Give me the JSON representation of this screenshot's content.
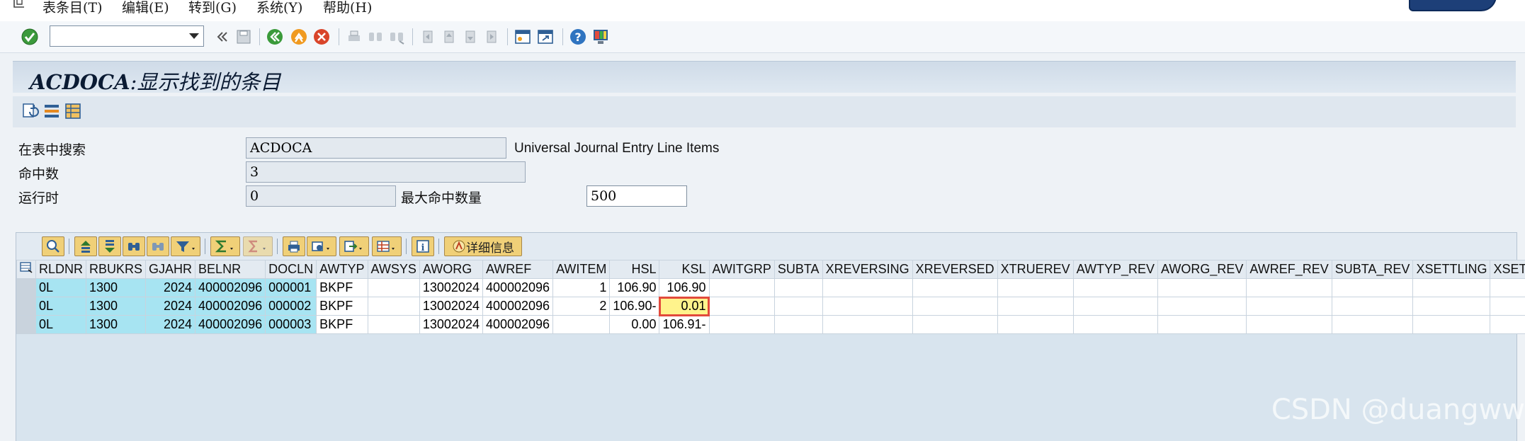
{
  "menu": {
    "items": [
      "表条目(T)",
      "编辑(E)",
      "转到(G)",
      "系统(Y)",
      "帮助(H)"
    ]
  },
  "toolbar": {
    "command_value": "",
    "icons": [
      "enter-icon",
      "back-icon",
      "exit-icon",
      "cancel-icon",
      "save-icon",
      "print-icon",
      "find-icon",
      "find-next-icon",
      "first-page-icon",
      "previous-page-icon",
      "next-page-icon",
      "last-page-icon",
      "create-session-icon",
      "shortcut-icon",
      "help-icon",
      "customize-layout-icon"
    ]
  },
  "title": {
    "table": "ACDOCA",
    "separator": ":",
    "text": "显示找到的条目"
  },
  "selection": {
    "search_label": "在表中搜索",
    "search_value": "ACDOCA",
    "search_desc": "Universal Journal Entry Line Items",
    "hits_label": "命中数",
    "hits_value": "3",
    "runtime_label": "运行时",
    "runtime_value": "0",
    "max_label": "最大命中数量",
    "max_value": "500"
  },
  "alv": {
    "detail_label": "详细信息",
    "columns": [
      "RLDNR",
      "RBUKRS",
      "GJAHR",
      "BELNR",
      "DOCLN",
      "AWTYP",
      "AWSYS",
      "AWORG",
      "AWREF",
      "AWITEM",
      "HSL",
      "KSL",
      "AWITGRP",
      "SUBTA",
      "XREVERSING",
      "XREVERSED",
      "XTRUEREV",
      "AWTYP_REV",
      "AWORG_REV",
      "AWREF_REV",
      "SUBTA_REV",
      "XSETTLING",
      "XSET..."
    ],
    "rows": [
      [
        "0L",
        "1300",
        "2024",
        "400002096",
        "000001",
        "BKPF",
        "",
        "13002024",
        "400002096",
        "1",
        "106.90",
        "106.90",
        "",
        "",
        "",
        "",
        "",
        "",
        "",
        "",
        "",
        "",
        ""
      ],
      [
        "0L",
        "1300",
        "2024",
        "400002096",
        "000002",
        "BKPF",
        "",
        "13002024",
        "400002096",
        "2",
        "106.90-",
        "0.01",
        "",
        "",
        "",
        "",
        "",
        "",
        "",
        "",
        "",
        "",
        ""
      ],
      [
        "0L",
        "1300",
        "2024",
        "400002096",
        "000003",
        "BKPF",
        "",
        "13002024",
        "400002096",
        "",
        "0.00",
        "106.91-",
        "",
        "",
        "",
        "",
        "",
        "",
        "",
        "",
        "",
        "",
        ""
      ]
    ]
  },
  "watermark": "CSDN @duangww",
  "colors": {
    "key_column": "#a7e4f2",
    "highlight_cell": "#fff38c",
    "highlight_border": "#e24a3c",
    "alv_background": "#d8e4ee"
  }
}
